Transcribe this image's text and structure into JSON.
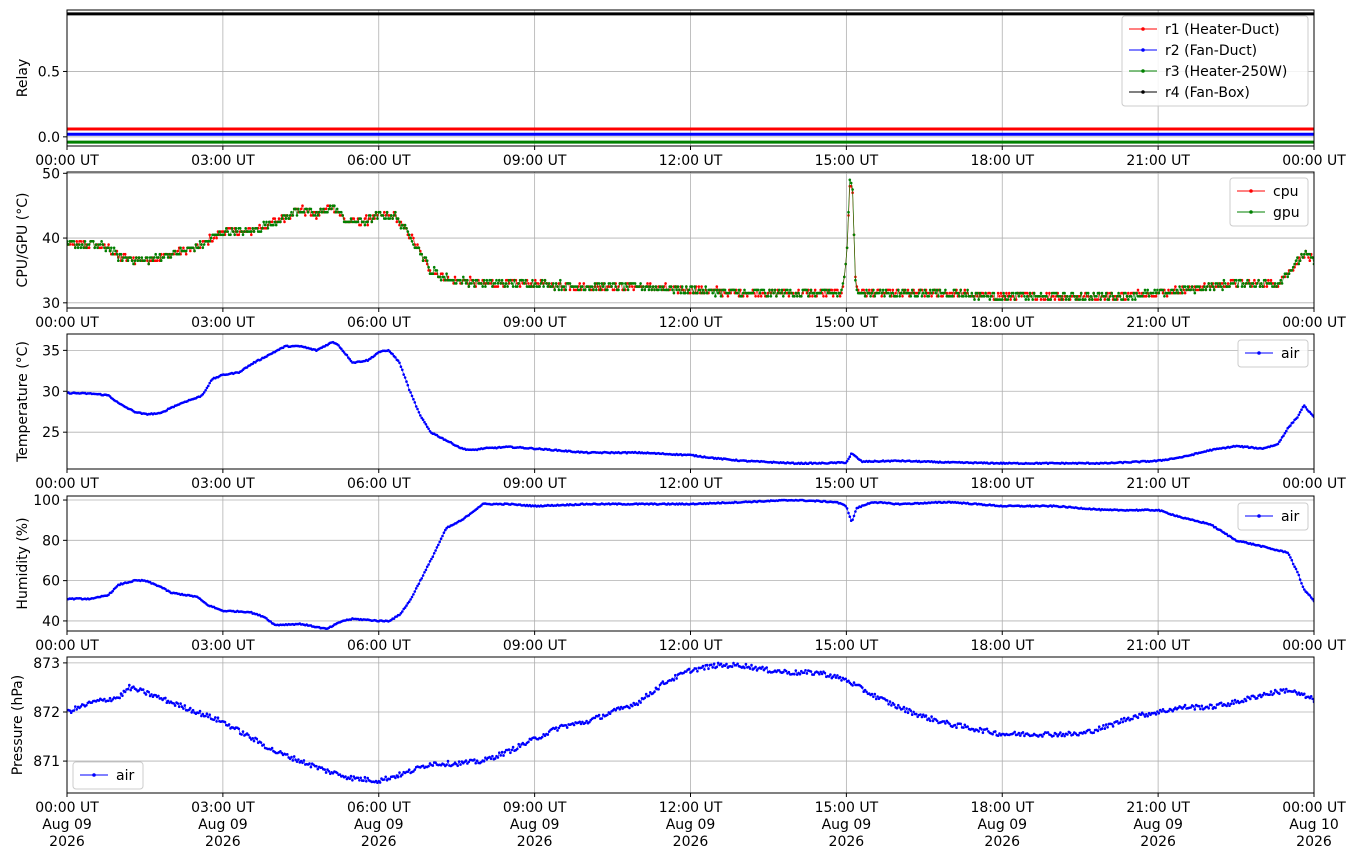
{
  "x_ticks": [
    "00:00 UT",
    "03:00 UT",
    "06:00 UT",
    "09:00 UT",
    "12:00 UT",
    "15:00 UT",
    "18:00 UT",
    "21:00 UT",
    "00:00 UT"
  ],
  "x_date_labels": [
    [
      "Aug 09",
      "2026"
    ],
    [
      "Aug 09",
      "2026"
    ],
    [
      "Aug 09",
      "2026"
    ],
    [
      "Aug 09",
      "2026"
    ],
    [
      "Aug 09",
      "2026"
    ],
    [
      "Aug 09",
      "2026"
    ],
    [
      "Aug 09",
      "2026"
    ],
    [
      "Aug 09",
      "2026"
    ],
    [
      "Aug 10",
      "2026"
    ]
  ],
  "chart_data": [
    {
      "type": "line",
      "ylabel": "Relay",
      "ylim": [
        -0.07,
        0.97
      ],
      "yticks": [
        0.0,
        0.5
      ],
      "ytick_labels": [
        "0.0",
        "0.5"
      ],
      "grid": true,
      "legend_position": "top-right",
      "x_range_hours": [
        0,
        24
      ],
      "series": [
        {
          "name": "r1 (Heater-Duct)",
          "color": "#ff0000",
          "hours": [
            0,
            24
          ],
          "values": [
            0.06,
            0.06
          ]
        },
        {
          "name": "r2 (Fan-Duct)",
          "color": "#0000ff",
          "hours": [
            0,
            24
          ],
          "values": [
            0.02,
            0.02
          ]
        },
        {
          "name": "r3 (Heater-250W)",
          "color": "#008000",
          "hours": [
            0,
            24
          ],
          "values": [
            -0.04,
            -0.04
          ]
        },
        {
          "name": "r4 (Fan-Box)",
          "color": "#000000",
          "hours": [
            0,
            24
          ],
          "values": [
            0.94,
            0.94
          ]
        }
      ]
    },
    {
      "type": "line",
      "ylabel": "CPU/GPU (°C)",
      "ylim": [
        29.2,
        50.2
      ],
      "yticks": [
        30,
        40,
        50
      ],
      "ytick_labels": [
        "30",
        "40",
        "50"
      ],
      "grid": true,
      "legend_position": "top-right",
      "x_range_hours": [
        0,
        24
      ],
      "series": [
        {
          "name": "cpu",
          "color": "#ff0000",
          "hours": [
            0,
            0.5,
            0.8,
            1.0,
            1.5,
            2.0,
            2.5,
            3.0,
            3.5,
            4.0,
            4.5,
            4.8,
            5.1,
            5.4,
            5.7,
            6.0,
            6.3,
            6.6,
            7.0,
            7.4,
            8.0,
            9.0,
            10.0,
            11.0,
            12.0,
            13.0,
            14.0,
            14.9,
            15.0,
            15.07,
            15.12,
            15.18,
            15.3,
            16.0,
            17.0,
            18.0,
            19.0,
            20.0,
            21.0,
            21.5,
            22.0,
            22.5,
            23.0,
            23.3,
            23.6,
            23.8,
            24.0
          ],
          "values": [
            39,
            39,
            38.5,
            37,
            36.5,
            37.5,
            38.5,
            41,
            41,
            42.5,
            44.5,
            43.5,
            45,
            42.5,
            42.5,
            43.5,
            43.5,
            40.5,
            35,
            33.5,
            33,
            33,
            32.5,
            32.5,
            32,
            31.5,
            31.5,
            31.5,
            36,
            49,
            47,
            32.5,
            31.5,
            31.5,
            31.5,
            31,
            31,
            31,
            31.5,
            32,
            32.5,
            33,
            33,
            33,
            35.5,
            37.5,
            36.5
          ]
        },
        {
          "name": "gpu",
          "color": "#008000",
          "hours": [
            0,
            0.5,
            0.8,
            1.0,
            1.5,
            2.0,
            2.5,
            3.0,
            3.5,
            4.0,
            4.5,
            4.8,
            5.1,
            5.4,
            5.7,
            6.0,
            6.3,
            6.6,
            7.0,
            7.4,
            8.0,
            9.0,
            10.0,
            11.0,
            12.0,
            13.0,
            14.0,
            14.9,
            15.0,
            15.07,
            15.12,
            15.18,
            15.3,
            16.0,
            17.0,
            18.0,
            19.0,
            20.0,
            21.0,
            21.5,
            22.0,
            22.5,
            23.0,
            23.3,
            23.6,
            23.8,
            24.0
          ],
          "values": [
            39,
            39,
            38.5,
            37,
            36.5,
            37.5,
            38.5,
            41,
            41,
            42.5,
            44.5,
            43.5,
            45,
            42.5,
            42.5,
            43.5,
            43.5,
            40.5,
            35,
            33.5,
            33,
            33,
            32.5,
            32.5,
            32,
            31.5,
            31.5,
            31.5,
            36,
            49.5,
            47,
            32.5,
            31.5,
            31.5,
            31.5,
            31,
            31,
            31,
            31.5,
            32,
            32.5,
            33,
            33,
            33,
            35.5,
            37.5,
            36.5
          ]
        }
      ]
    },
    {
      "type": "line",
      "ylabel": "Temperature (°C)",
      "ylim": [
        20.5,
        37.0
      ],
      "yticks": [
        25,
        30,
        35
      ],
      "ytick_labels": [
        "25",
        "30",
        "35"
      ],
      "grid": true,
      "legend_position": "top-right",
      "x_range_hours": [
        0,
        24
      ],
      "series": [
        {
          "name": "air",
          "color": "#0000ff",
          "hours": [
            0,
            0.5,
            0.8,
            1.0,
            1.3,
            1.5,
            1.8,
            2.0,
            2.3,
            2.5,
            2.6,
            2.8,
            3.0,
            3.3,
            3.6,
            3.9,
            4.2,
            4.5,
            4.8,
            5.1,
            5.2,
            5.5,
            5.8,
            6.0,
            6.2,
            6.4,
            6.6,
            6.8,
            7.0,
            7.3,
            7.6,
            7.8,
            8.0,
            8.5,
            9.0,
            10.0,
            11.0,
            12.0,
            12.5,
            13.0,
            14.0,
            14.5,
            15.0,
            15.1,
            15.3,
            16.0,
            17.0,
            18.0,
            19.0,
            20.0,
            21.0,
            21.5,
            22.0,
            22.5,
            23.0,
            23.3,
            23.5,
            23.7,
            23.8,
            24.0
          ],
          "values": [
            29.8,
            29.7,
            29.5,
            28.5,
            27.5,
            27.2,
            27.3,
            28.0,
            28.8,
            29.2,
            29.5,
            31.5,
            32.0,
            32.3,
            33.5,
            34.5,
            35.5,
            35.5,
            35.0,
            36.0,
            35.8,
            33.5,
            33.8,
            34.8,
            35.0,
            33.5,
            30.0,
            27.0,
            25.0,
            24.0,
            23.0,
            22.8,
            23.0,
            23.2,
            23.0,
            22.5,
            22.5,
            22.2,
            21.8,
            21.5,
            21.2,
            21.2,
            21.3,
            22.4,
            21.4,
            21.5,
            21.3,
            21.2,
            21.2,
            21.2,
            21.5,
            22.0,
            22.8,
            23.3,
            23.0,
            23.5,
            25.5,
            27.0,
            28.3,
            26.8
          ]
        }
      ]
    },
    {
      "type": "line",
      "ylabel": "Humidity (%)",
      "ylim": [
        35,
        102
      ],
      "yticks": [
        40,
        60,
        80,
        100
      ],
      "ytick_labels": [
        "40",
        "60",
        "80",
        "100"
      ],
      "grid": true,
      "legend_position": "top-right",
      "x_range_hours": [
        0,
        24
      ],
      "series": [
        {
          "name": "air",
          "color": "#0000ff",
          "hours": [
            0,
            0.5,
            0.8,
            1.0,
            1.3,
            1.5,
            1.8,
            2.0,
            2.5,
            2.7,
            3.0,
            3.5,
            3.8,
            4.0,
            4.5,
            4.8,
            5.0,
            5.3,
            5.5,
            5.8,
            6.0,
            6.2,
            6.4,
            6.6,
            6.8,
            7.0,
            7.3,
            7.6,
            7.8,
            8.0,
            8.5,
            9.0,
            10.0,
            11.0,
            12.0,
            13.0,
            14.0,
            14.8,
            15.0,
            15.1,
            15.2,
            15.5,
            16.0,
            17.0,
            18.0,
            19.0,
            20.0,
            21.0,
            21.5,
            22.0,
            22.5,
            23.0,
            23.3,
            23.5,
            23.7,
            23.8,
            24.0
          ],
          "values": [
            51,
            51,
            53,
            58,
            60,
            60,
            57,
            54,
            52,
            48,
            45,
            44.5,
            42,
            38,
            38.5,
            37,
            36,
            40,
            41,
            40.5,
            40,
            40,
            43,
            50,
            60,
            70,
            86,
            90,
            94,
            98,
            98,
            97,
            98,
            98,
            98,
            99,
            100,
            99,
            97,
            89,
            96,
            99,
            98,
            99,
            97,
            97,
            95,
            95,
            91,
            88,
            80,
            77,
            75,
            74,
            63,
            56,
            50,
            53
          ]
        }
      ]
    },
    {
      "type": "line",
      "ylabel": "Pressure (hPa)",
      "ylim": [
        870.35,
        873.12
      ],
      "yticks": [
        871,
        872,
        873
      ],
      "ytick_labels": [
        "871",
        "872",
        "873"
      ],
      "grid": true,
      "legend_position": "bottom-left",
      "x_range_hours": [
        0,
        24
      ],
      "series": [
        {
          "name": "air",
          "color": "#0000ff",
          "hours": [
            0,
            0.5,
            1.0,
            1.2,
            1.5,
            2.0,
            2.5,
            3.0,
            3.5,
            4.0,
            4.5,
            5.0,
            5.5,
            6.0,
            6.5,
            7.0,
            7.5,
            8.0,
            8.5,
            9.0,
            9.5,
            10.0,
            10.5,
            11.0,
            11.5,
            12.0,
            12.5,
            13.0,
            13.5,
            14.0,
            14.5,
            15.0,
            15.5,
            16.0,
            16.5,
            17.0,
            17.5,
            18.0,
            18.5,
            19.0,
            19.5,
            20.0,
            20.5,
            21.0,
            21.5,
            22.0,
            22.5,
            23.0,
            23.5,
            24.0
          ],
          "values": [
            872.0,
            872.2,
            872.3,
            872.5,
            872.4,
            872.2,
            872.0,
            871.8,
            871.5,
            871.2,
            871.0,
            870.8,
            870.65,
            870.6,
            870.75,
            870.95,
            870.95,
            871.0,
            871.2,
            871.45,
            871.7,
            871.8,
            872.0,
            872.2,
            872.6,
            872.85,
            872.95,
            872.95,
            872.85,
            872.8,
            872.8,
            872.65,
            872.35,
            872.1,
            871.9,
            871.75,
            871.65,
            871.55,
            871.55,
            871.55,
            871.55,
            871.7,
            871.9,
            872.0,
            872.1,
            872.1,
            872.2,
            872.35,
            872.45,
            872.25
          ]
        }
      ]
    }
  ]
}
